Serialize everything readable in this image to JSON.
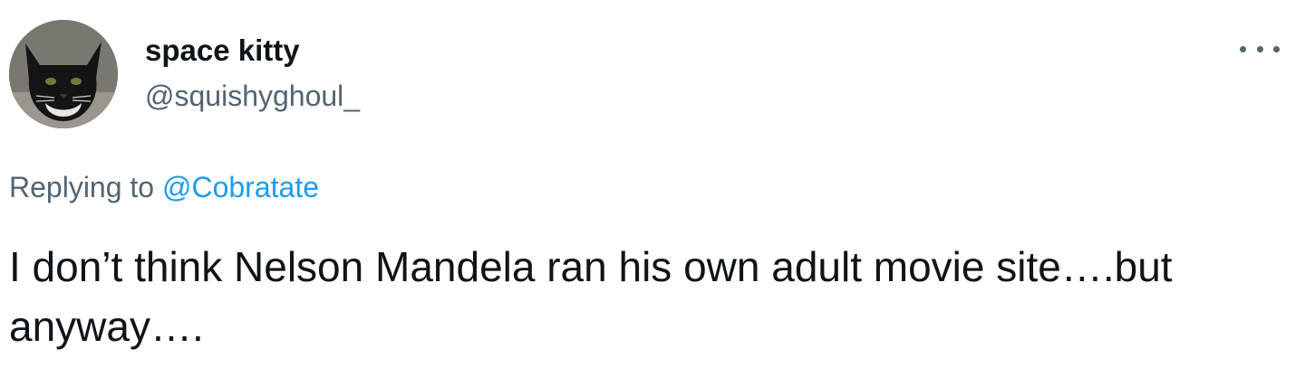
{
  "tweet": {
    "author": {
      "display_name": "space kitty",
      "handle": "@squishyghoul_",
      "avatar_icon": "cat-avatar"
    },
    "more_icon": "more-options-icon",
    "replying_to": {
      "prefix": "Replying to",
      "mention": "@Cobratate"
    },
    "text": "I don’t think Nelson Mandela ran his own adult movie site….but anyway…."
  },
  "colors": {
    "primary_text": "#0f1419",
    "secondary_text": "#536471",
    "link": "#1d9bf0",
    "background": "#ffffff"
  }
}
